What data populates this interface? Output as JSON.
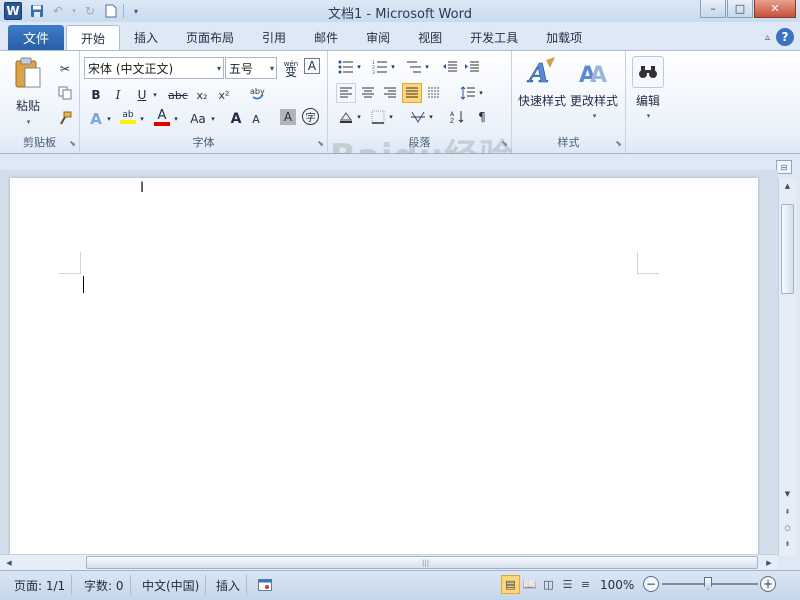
{
  "window": {
    "title": "文档1  -  Microsoft Word",
    "app_icon_letter": "W",
    "controls": {
      "minimize": "–",
      "maximize": "□",
      "close": "✕"
    }
  },
  "quick_access": {
    "save_icon": "floppy-save-icon",
    "undo_icon": "undo-icon",
    "redo_icon": "redo-icon",
    "new_icon": "new-doc-icon",
    "customize_icon": "customize-qat-icon"
  },
  "tabs": {
    "file": "文件",
    "items": [
      "开始",
      "插入",
      "页面布局",
      "引用",
      "邮件",
      "审阅",
      "视图",
      "开发工具",
      "加载项"
    ],
    "active_index": 0
  },
  "help": {
    "label": "?"
  },
  "ribbon": {
    "clipboard": {
      "label": "剪贴板",
      "paste": "粘贴"
    },
    "font": {
      "label": "字体",
      "font_name": "宋体 (中文正文)",
      "font_size": "五号",
      "phonetic": "wén",
      "bold": "B",
      "italic": "I",
      "underline": "U",
      "strike": "abc",
      "subscript": "x₂",
      "superscript": "x²",
      "grow": "A",
      "shrink": "A",
      "case": "Aa",
      "char_border": "A",
      "char_shade": "A",
      "enclose": "字"
    },
    "paragraph": {
      "label": "段落"
    },
    "styles": {
      "label": "样式",
      "quick_styles": "快速样式",
      "change_styles": "更改样式"
    },
    "editing": {
      "label": "编辑"
    }
  },
  "status": {
    "page": "页面: 1/1",
    "words": "字数: 0",
    "language": "中文(中国)",
    "mode": "插入",
    "zoom": "100%",
    "zoom_level": 1.0
  },
  "watermark": {
    "main": "Baidu经验",
    "sub": "jingyan.baidu.com"
  },
  "colors": {
    "file_tab": "#2a5ea8",
    "highlight": "#fff200",
    "font_color": "#e00000",
    "accent": "#3b73c2"
  }
}
